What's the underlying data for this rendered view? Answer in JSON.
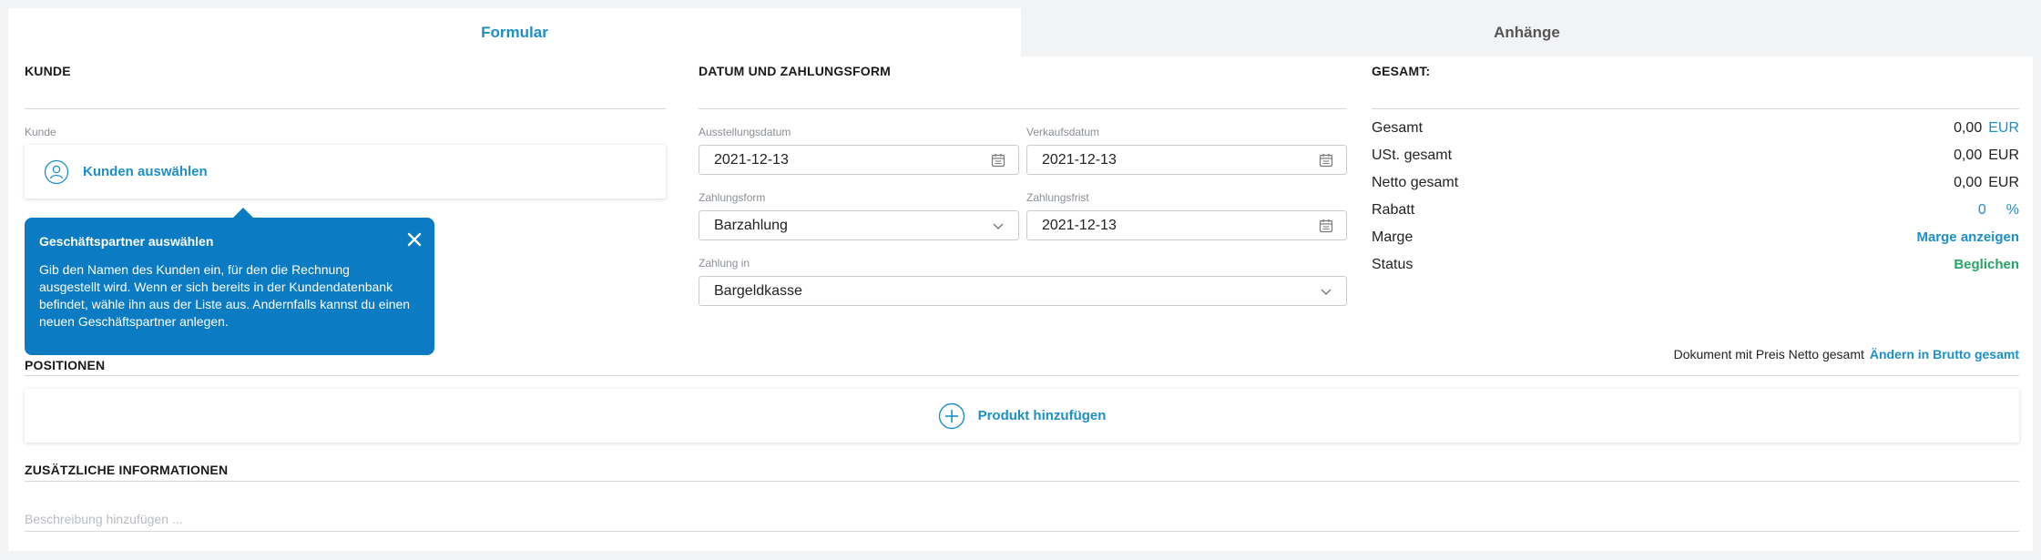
{
  "tabs": [
    {
      "label": "Formular"
    },
    {
      "label": "Anhänge"
    }
  ],
  "customer": {
    "section_title": "KUNDE",
    "field_label": "Kunde",
    "select_label": "Kunden auswählen"
  },
  "tooltip": {
    "title": "Geschäftspartner auswählen",
    "body": "Gib den Namen des Kunden ein, für den die Rechnung ausgestellt wird. Wenn er sich bereits in der Kundendatenbank befindet, wähle ihn aus der Liste aus. Andernfalls kannst du einen neuen Geschäftspartner anlegen."
  },
  "date_payment": {
    "section_title": "DATUM UND ZAHLUNGSFORM",
    "issue_date_label": "Ausstellungsdatum",
    "issue_date_value": "2021-12-13",
    "sale_date_label": "Verkaufsdatum",
    "sale_date_value": "2021-12-13",
    "payment_form_label": "Zahlungsform",
    "payment_form_value": "Barzahlung",
    "payment_due_label": "Zahlungsfrist",
    "payment_due_value": "2021-12-13",
    "payment_in_label": "Zahlung in",
    "payment_in_value": "Bargeldkasse"
  },
  "totals": {
    "section_title": "GESAMT:",
    "total_label": "Gesamt",
    "total_value": "0,00",
    "total_currency": "EUR",
    "vat_label": "USt. gesamt",
    "vat_value": "0,00",
    "vat_currency": "EUR",
    "net_label": "Netto gesamt",
    "net_value": "0,00",
    "net_currency": "EUR",
    "discount_label": "Rabatt",
    "discount_value": "0",
    "discount_unit": "%",
    "margin_label": "Marge",
    "margin_link": "Marge anzeigen",
    "status_label": "Status",
    "status_value": "Beglichen"
  },
  "price_mode": {
    "text": "Dokument mit Preis Netto gesamt",
    "link": "Ändern in Brutto gesamt"
  },
  "positions": {
    "section_title": "POSITIONEN",
    "add_product_label": "Produkt hinzufügen"
  },
  "additional": {
    "section_title": "ZUSÄTZLICHE INFORMATIONEN",
    "description_placeholder": "Beschreibung hinzufügen ..."
  },
  "colors": {
    "accent": "#1d8fc7",
    "tooltip_bg": "#0b7cc3",
    "status_green": "#27a565"
  },
  "icons": {
    "customer": "user-circle-icon",
    "calendar": "calendar-icon",
    "dropdown": "chevron-down-icon",
    "close": "close-icon",
    "add": "plus-circle-icon"
  }
}
